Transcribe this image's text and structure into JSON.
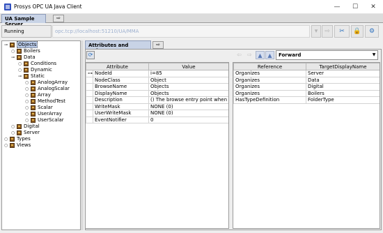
{
  "window": {
    "title": "Prosys OPC UA Java Client",
    "minimize_glyph": "—",
    "maximize_glyph": "☐",
    "close_glyph": "✕"
  },
  "server_tab": {
    "label": "UA Sample Server",
    "add_glyph": "⇨"
  },
  "status": {
    "connection": "Running",
    "url": "opc.tcp://localhost:51210/UA/MMA"
  },
  "toolbar": {
    "dropdown_glyph": "▾",
    "connect_glyph": "⇨",
    "disconnect_glyph": "✂",
    "lock_glyph": "🔒",
    "settings_glyph": "⚙"
  },
  "tree": {
    "items": [
      {
        "label": "Objects",
        "depth": 0,
        "expanded": true,
        "selected": true,
        "kind": "object"
      },
      {
        "label": "Boilers",
        "depth": 1,
        "expanded": false,
        "kind": "object"
      },
      {
        "label": "Data",
        "depth": 1,
        "expanded": true,
        "kind": "object"
      },
      {
        "label": "Conditions",
        "depth": 2,
        "expanded": false,
        "kind": "object"
      },
      {
        "label": "Dynamic",
        "depth": 2,
        "expanded": false,
        "kind": "object"
      },
      {
        "label": "Static",
        "depth": 2,
        "expanded": true,
        "kind": "object"
      },
      {
        "label": "AnalogArray",
        "depth": 3,
        "expanded": false,
        "kind": "object"
      },
      {
        "label": "AnalogScalar",
        "depth": 3,
        "expanded": false,
        "kind": "object"
      },
      {
        "label": "Array",
        "depth": 3,
        "expanded": false,
        "kind": "object"
      },
      {
        "label": "MethodTest",
        "depth": 3,
        "expanded": false,
        "kind": "object"
      },
      {
        "label": "Scalar",
        "depth": 3,
        "expanded": false,
        "kind": "object"
      },
      {
        "label": "UserArray",
        "depth": 3,
        "expanded": false,
        "kind": "object"
      },
      {
        "label": "UserScalar",
        "depth": 3,
        "expanded": false,
        "kind": "object"
      },
      {
        "label": "Digital",
        "depth": 1,
        "expanded": false,
        "kind": "object"
      },
      {
        "label": "Server",
        "depth": 1,
        "expanded": false,
        "kind": "object"
      },
      {
        "label": "Types",
        "depth": 0,
        "expanded": false,
        "kind": "object"
      },
      {
        "label": "Views",
        "depth": 0,
        "expanded": false,
        "kind": "object"
      }
    ]
  },
  "attributes_tab": {
    "label": "Attributes and References",
    "add_glyph": "⇨",
    "tool_glyph": "⟳"
  },
  "attributes": {
    "columns": [
      "Attribute",
      "Value"
    ],
    "rows": [
      {
        "marker": "⊶",
        "name": "NodeId",
        "value": "i=85"
      },
      {
        "marker": "",
        "name": "NodeClass",
        "value": "Object"
      },
      {
        "marker": "",
        "name": "BrowseName",
        "value": "Objects"
      },
      {
        "marker": "",
        "name": "DisplayName",
        "value": "Objects"
      },
      {
        "marker": "",
        "name": "Description",
        "value": "() The browse entry point when l..."
      },
      {
        "marker": "",
        "name": "WriteMask",
        "value": "NONE  (0)"
      },
      {
        "marker": "",
        "name": "UserWriteMask",
        "value": "NONE  (0)"
      },
      {
        "marker": "",
        "name": "EventNotifier",
        "value": "0"
      }
    ]
  },
  "references": {
    "back_glyph": "⇦",
    "forward_glyph": "⇨",
    "filter1_glyph": "▲",
    "filter2_glyph": "▲",
    "direction": "Forward",
    "direction_arrow": "▼",
    "columns": [
      "Reference",
      "TargetDisplayName"
    ],
    "rows": [
      {
        "reference": "Organizes",
        "target": "Server"
      },
      {
        "reference": "Organizes",
        "target": "Data"
      },
      {
        "reference": "Organizes",
        "target": "Digital"
      },
      {
        "reference": "Organizes",
        "target": "Boilers"
      },
      {
        "reference": "HasTypeDefinition",
        "target": "FolderType"
      }
    ]
  }
}
